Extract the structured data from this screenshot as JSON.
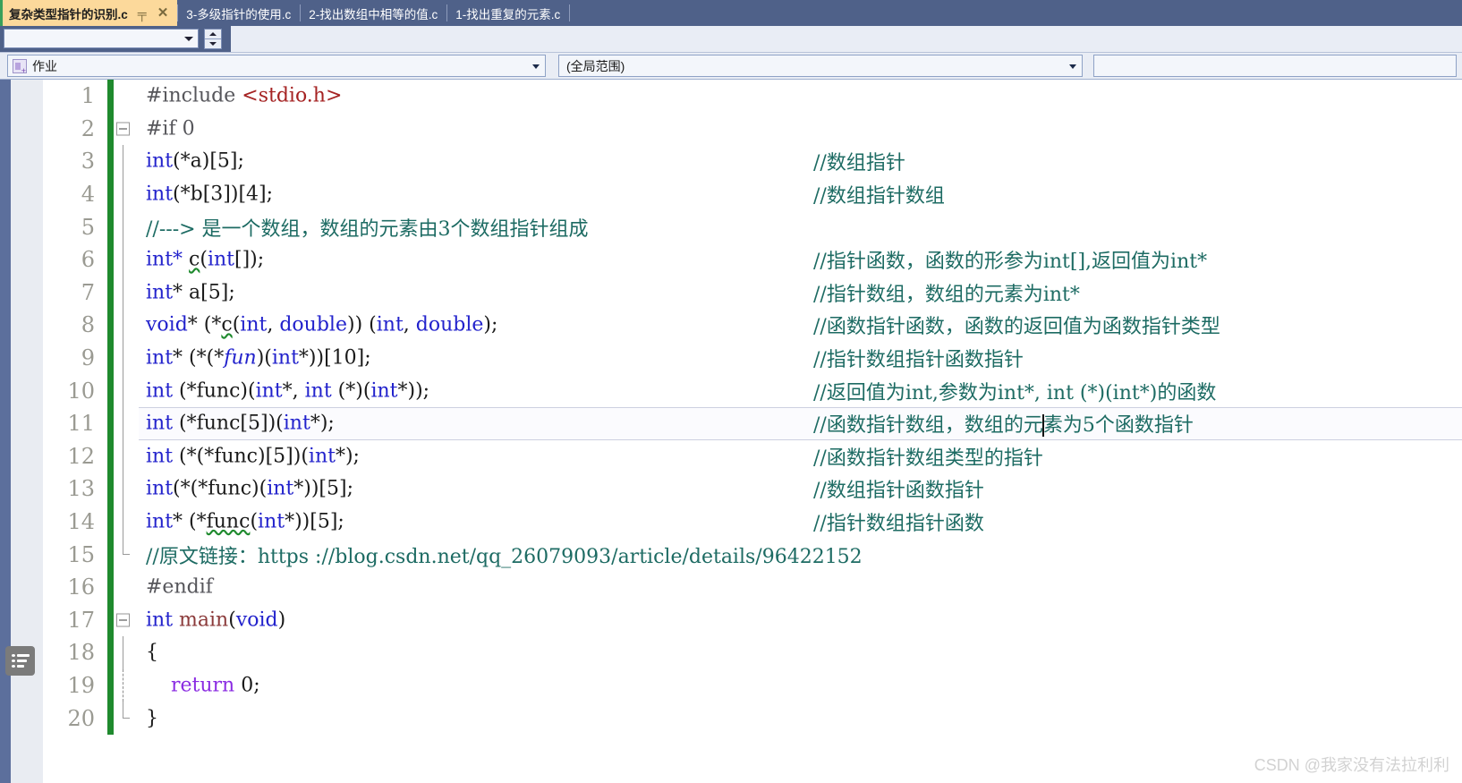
{
  "window": {
    "watermark": "CSDN @我家没有法拉利利"
  },
  "tabs": [
    {
      "label": "复杂类型指针的识别.c",
      "active": true,
      "pin_icon": "pin-icon",
      "close_icon": "close-icon"
    },
    {
      "label": "3-多级指针的使用.c",
      "active": false
    },
    {
      "label": "2-找出数组中相等的值.c",
      "active": false
    },
    {
      "label": "1-找出重复的元素.c",
      "active": false
    }
  ],
  "toolbar": {
    "small_combo_value": "",
    "spinner_up": "▲",
    "spinner_down": "▼"
  },
  "navbar": {
    "project_combo": {
      "value": "作业",
      "icon": "project-icon"
    },
    "scope_combo": {
      "value": "(全局范围)"
    },
    "member_combo": {
      "value": ""
    }
  },
  "editor": {
    "lines": [
      {
        "no": "1",
        "fold": "none",
        "indent": "none",
        "segments": [
          {
            "t": "#include ",
            "c": "pp"
          },
          {
            "t": "<stdio.h>",
            "c": "str"
          }
        ],
        "comment": ""
      },
      {
        "no": "2",
        "fold": "minus",
        "indent": "none",
        "segments": [
          {
            "t": "#if 0",
            "c": "pp"
          }
        ],
        "comment": ""
      },
      {
        "no": "3",
        "fold": "none",
        "indent": "line",
        "segments": [
          {
            "t": "int",
            "c": "kw"
          },
          {
            "t": "(*a)[5];",
            "c": "plain"
          }
        ],
        "comment": "//数组指针"
      },
      {
        "no": "4",
        "fold": "none",
        "indent": "line",
        "segments": [
          {
            "t": "int",
            "c": "kw"
          },
          {
            "t": "(*b[3])[4];",
            "c": "plain"
          }
        ],
        "comment": "//数组指针数组"
      },
      {
        "no": "5",
        "fold": "none",
        "indent": "line",
        "segments": [
          {
            "t": "//---> 是一个数组，数组的元素由3个数组指针组成",
            "c": "cmtx"
          }
        ],
        "comment": ""
      },
      {
        "no": "6",
        "fold": "none",
        "indent": "line",
        "segments": [
          {
            "t": "int",
            "c": "kw"
          },
          {
            "t": "* ",
            "c": "kw"
          },
          {
            "t": "c",
            "c": "sqk"
          },
          {
            "t": "(",
            "c": "plain"
          },
          {
            "t": "int",
            "c": "kw"
          },
          {
            "t": "[]);",
            "c": "plain"
          }
        ],
        "comment": "//指针函数，函数的形参为int[],返回值为int*"
      },
      {
        "no": "7",
        "fold": "none",
        "indent": "line",
        "segments": [
          {
            "t": "int",
            "c": "kw"
          },
          {
            "t": "* a[5];",
            "c": "plain"
          }
        ],
        "comment": "//指针数组，数组的元素为int*"
      },
      {
        "no": "8",
        "fold": "none",
        "indent": "line",
        "segments": [
          {
            "t": "void",
            "c": "kw"
          },
          {
            "t": "* (*",
            "c": "plain"
          },
          {
            "t": "c",
            "c": "sqk"
          },
          {
            "t": "(",
            "c": "plain"
          },
          {
            "t": "int",
            "c": "kw"
          },
          {
            "t": ", ",
            "c": "plain"
          },
          {
            "t": "double",
            "c": "kw"
          },
          {
            "t": ")) (",
            "c": "plain"
          },
          {
            "t": "int",
            "c": "kw"
          },
          {
            "t": ", ",
            "c": "plain"
          },
          {
            "t": "double",
            "c": "kw"
          },
          {
            "t": ");",
            "c": "plain"
          }
        ],
        "comment": "//函数指针函数，函数的返回值为函数指针类型"
      },
      {
        "no": "9",
        "fold": "none",
        "indent": "line",
        "segments": [
          {
            "t": "int",
            "c": "kw"
          },
          {
            "t": "* (*(*",
            "c": "plain"
          },
          {
            "t": "fun",
            "c": "ital"
          },
          {
            "t": ")(",
            "c": "plain"
          },
          {
            "t": "int",
            "c": "kw"
          },
          {
            "t": "*))[10];",
            "c": "plain"
          }
        ],
        "comment": "//指针数组指针函数指针"
      },
      {
        "no": "10",
        "fold": "none",
        "indent": "line",
        "segments": [
          {
            "t": "int",
            "c": "kw"
          },
          {
            "t": " (*func)(",
            "c": "plain"
          },
          {
            "t": "int",
            "c": "kw"
          },
          {
            "t": "*, ",
            "c": "plain"
          },
          {
            "t": "int",
            "c": "kw"
          },
          {
            "t": " (*)(",
            "c": "plain"
          },
          {
            "t": "int",
            "c": "kw"
          },
          {
            "t": "*));",
            "c": "plain"
          }
        ],
        "comment": "//返回值为int,参数为int*, int (*)(int*)的函数"
      },
      {
        "no": "11",
        "fold": "none",
        "indent": "line",
        "current": true,
        "segments": [
          {
            "t": "int",
            "c": "kw"
          },
          {
            "t": " (*func[5])(",
            "c": "plain"
          },
          {
            "t": "int",
            "c": "kw"
          },
          {
            "t": "*);",
            "c": "plain"
          }
        ],
        "comment_before": "//函数指针数组，数组的元",
        "caret": true,
        "comment_after": "素为5个函数指针"
      },
      {
        "no": "12",
        "fold": "none",
        "indent": "line",
        "segments": [
          {
            "t": "int",
            "c": "kw"
          },
          {
            "t": " (*(*func)[5])(",
            "c": "plain"
          },
          {
            "t": "int",
            "c": "kw"
          },
          {
            "t": "*);",
            "c": "plain"
          }
        ],
        "comment": "//函数指针数组类型的指针"
      },
      {
        "no": "13",
        "fold": "none",
        "indent": "line",
        "segments": [
          {
            "t": "int",
            "c": "kw"
          },
          {
            "t": "(*(*func)(",
            "c": "plain"
          },
          {
            "t": "int",
            "c": "kw"
          },
          {
            "t": "*))[5];",
            "c": "plain"
          }
        ],
        "comment": "//数组指针函数指针"
      },
      {
        "no": "14",
        "fold": "none",
        "indent": "line",
        "segments": [
          {
            "t": "int",
            "c": "kw"
          },
          {
            "t": "* (*",
            "c": "plain"
          },
          {
            "t": "func",
            "c": "sqp"
          },
          {
            "t": "(",
            "c": "plain"
          },
          {
            "t": "int",
            "c": "kw"
          },
          {
            "t": "*))[5];",
            "c": "plain"
          }
        ],
        "comment": "//指针数组指针函数"
      },
      {
        "no": "15",
        "fold": "none",
        "indent": "endline",
        "segments": [
          {
            "t": "//原文链接：https ://blog.csdn.net/qq_26079093/article/details/96422152",
            "c": "cmtx"
          }
        ],
        "comment": ""
      },
      {
        "no": "16",
        "fold": "none",
        "indent": "none",
        "segments": [
          {
            "t": "#endif",
            "c": "pp"
          }
        ],
        "comment": ""
      },
      {
        "no": "17",
        "fold": "minus",
        "indent": "none",
        "segments": [
          {
            "t": "int",
            "c": "kw"
          },
          {
            "t": " ",
            "c": "plain"
          },
          {
            "t": "main",
            "c": "fn"
          },
          {
            "t": "(",
            "c": "plain"
          },
          {
            "t": "void",
            "c": "kw"
          },
          {
            "t": ")",
            "c": "plain"
          }
        ],
        "comment": ""
      },
      {
        "no": "18",
        "fold": "none",
        "indent": "line",
        "segments": [
          {
            "t": "{",
            "c": "plain"
          }
        ],
        "comment": ""
      },
      {
        "no": "19",
        "fold": "none",
        "indent": "dashed",
        "segments": [
          {
            "t": "    ",
            "c": "plain"
          },
          {
            "t": "return",
            "c": "ret"
          },
          {
            "t": " 0;",
            "c": "plain"
          }
        ],
        "comment": ""
      },
      {
        "no": "20",
        "fold": "none",
        "indent": "endline",
        "segments": [
          {
            "t": "}",
            "c": "plain"
          }
        ],
        "comment": ""
      }
    ]
  },
  "colors": {
    "tabbar_bg": "#4f6189",
    "active_tab_bg": "#fcd99b",
    "keyword": "#2222cc",
    "comment": "#1d6b63",
    "string": "#a52323",
    "preproc": "#56565b",
    "return_kw": "#8a2be2",
    "function": "#8b3a3a",
    "change_bar": "#1f8a2e"
  }
}
